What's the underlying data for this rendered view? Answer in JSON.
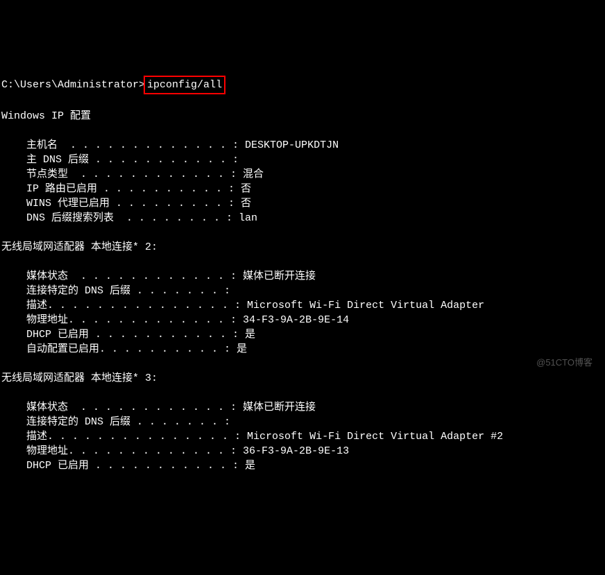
{
  "prompt": {
    "path": "C:\\Users\\Administrator>",
    "command": "ipconfig/all"
  },
  "header": "Windows IP 配置",
  "ip_config": {
    "hostname": {
      "label": "主机名  . . . . . . . . . . . . . :",
      "value": " DESKTOP-UPKDTJN"
    },
    "primary_dns_suffix": {
      "label": "主 DNS 后缀 . . . . . . . . . . . :",
      "value": ""
    },
    "node_type": {
      "label": "节点类型  . . . . . . . . . . . . :",
      "value": " 混合"
    },
    "ip_routing": {
      "label": "IP 路由已启用 . . . . . . . . . . :",
      "value": " 否"
    },
    "wins_proxy": {
      "label": "WINS 代理已启用 . . . . . . . . . :",
      "value": " 否"
    },
    "dns_suffix_search": {
      "label": "DNS 后缀搜索列表  . . . . . . . . :",
      "value": " lan"
    }
  },
  "adapter1": {
    "title": "无线局域网适配器 本地连接* 2:",
    "media_state": {
      "label": "媒体状态  . . . . . . . . . . . . :",
      "value": " 媒体已断开连接"
    },
    "conn_dns_suffix": {
      "label": "连接特定的 DNS 后缀 . . . . . . . :",
      "value": ""
    },
    "description": {
      "label": "描述. . . . . . . . . . . . . . . :",
      "value": " Microsoft Wi-Fi Direct Virtual Adapter"
    },
    "physical_address": {
      "label": "物理地址. . . . . . . . . . . . . :",
      "value": " 34-F3-9A-2B-9E-14"
    },
    "dhcp_enabled": {
      "label": "DHCP 已启用 . . . . . . . . . . . :",
      "value": " 是"
    },
    "autoconfig_enabled": {
      "label": "自动配置已启用. . . . . . . . . . :",
      "value": " 是"
    }
  },
  "adapter2": {
    "title": "无线局域网适配器 本地连接* 3:",
    "media_state": {
      "label": "媒体状态  . . . . . . . . . . . . :",
      "value": " 媒体已断开连接"
    },
    "conn_dns_suffix": {
      "label": "连接特定的 DNS 后缀 . . . . . . . :",
      "value": ""
    },
    "description": {
      "label": "描述. . . . . . . . . . . . . . . :",
      "value": " Microsoft Wi-Fi Direct Virtual Adapter #2"
    },
    "physical_address": {
      "label": "物理地址. . . . . . . . . . . . . :",
      "value": " 36-F3-9A-2B-9E-13"
    },
    "dhcp_enabled": {
      "label": "DHCP 已启用 . . . . . . . . . . . :",
      "value": " 是"
    }
  },
  "watermark": "@51CTO博客"
}
